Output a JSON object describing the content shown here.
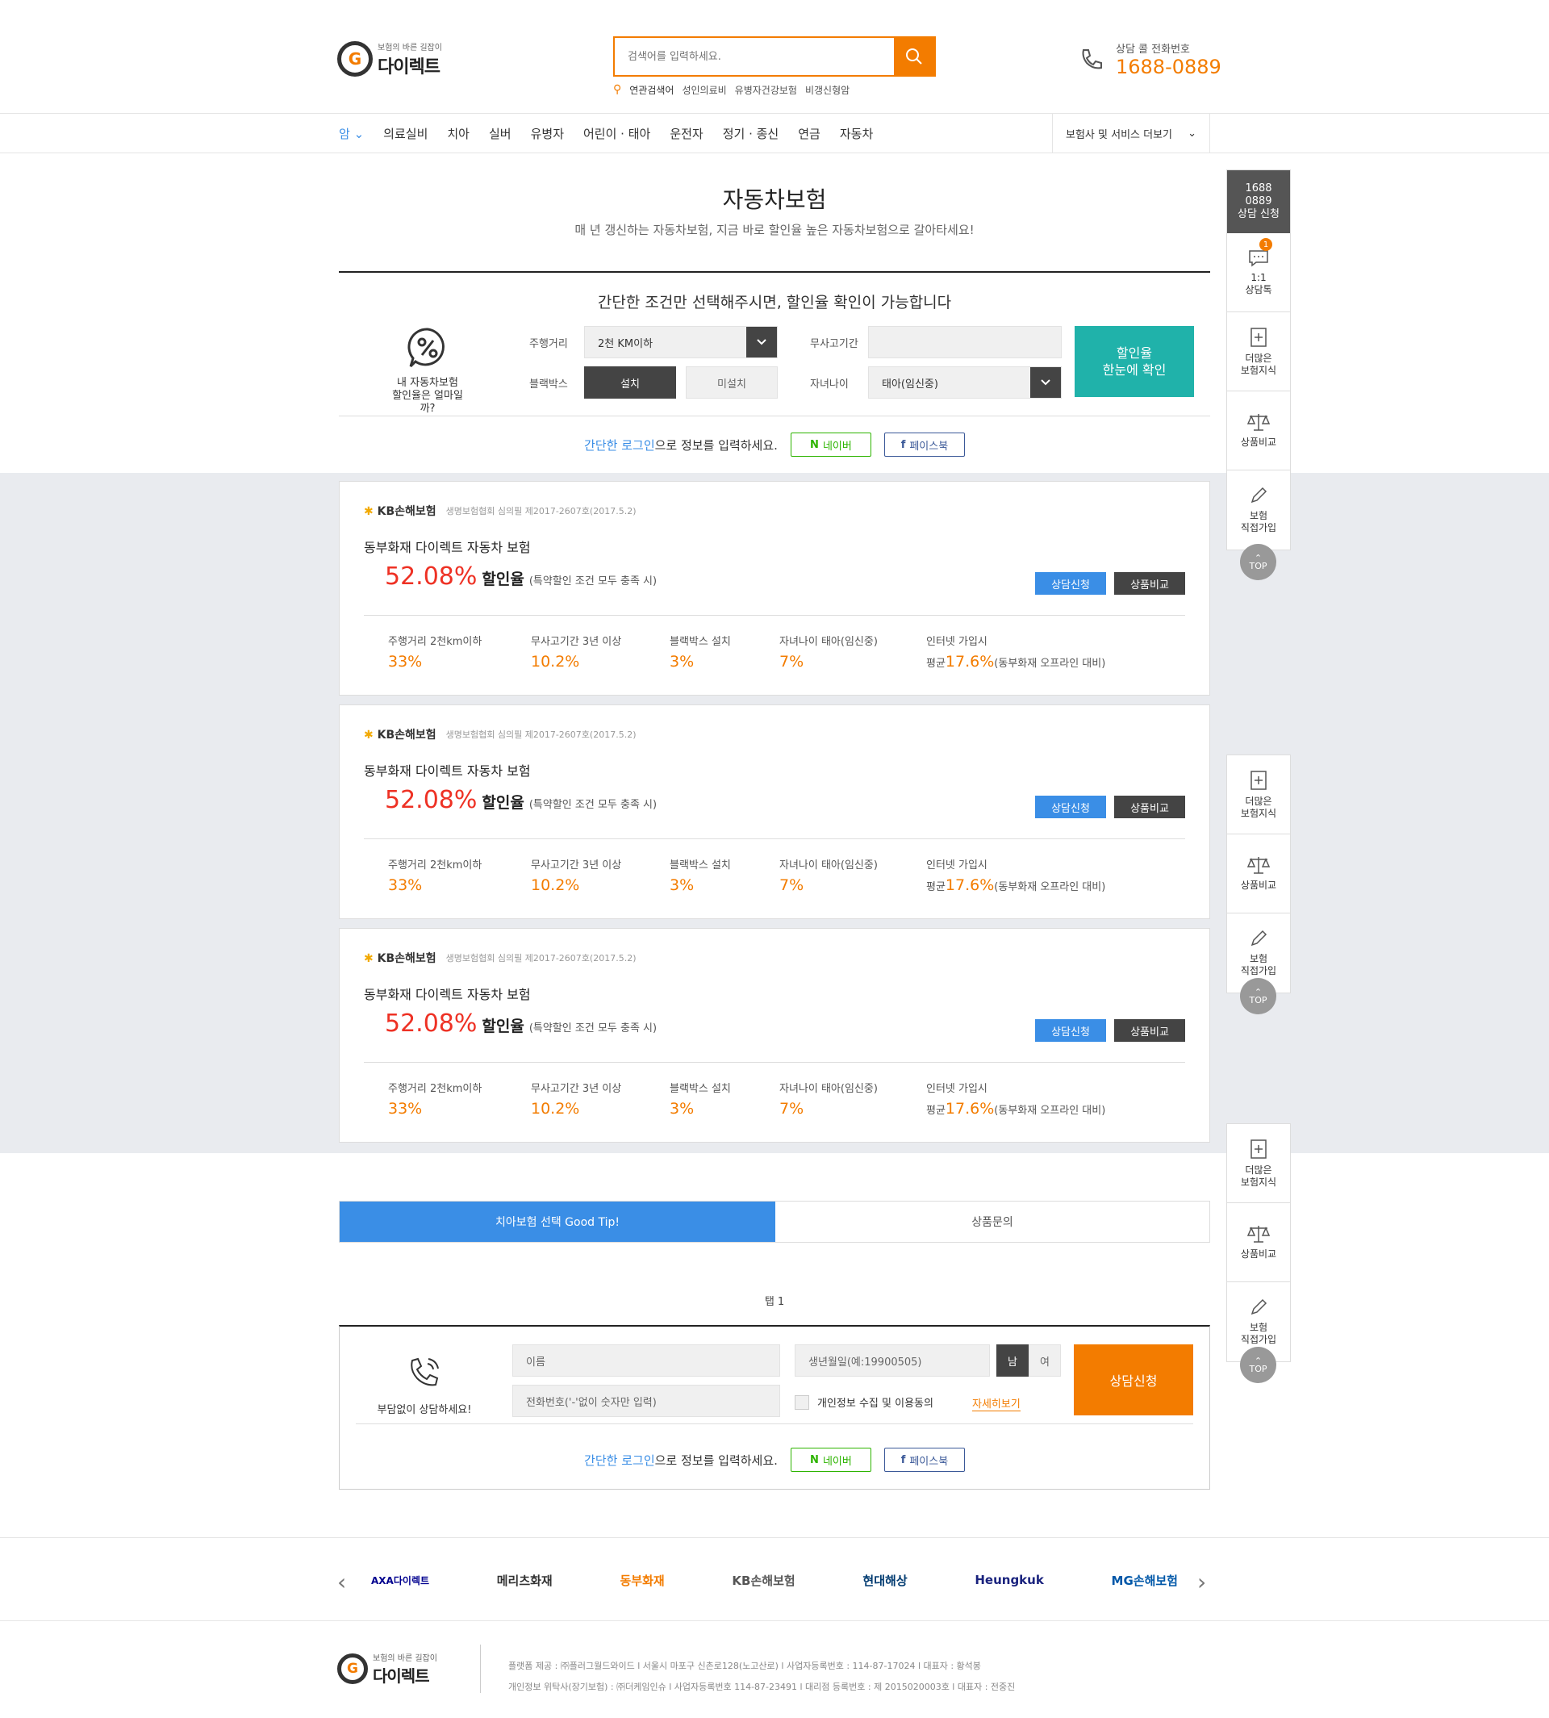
{
  "header": {
    "logo_sub": "보험의 바른 길잡이",
    "logo_main": "다이렉트",
    "search_placeholder": "검색어를 입력하세요.",
    "related_label": "연관검색어",
    "related_terms": [
      "성인의료비",
      "유병자건강보험",
      "비갱신형암"
    ],
    "phone_label": "상담 콜 전화번호",
    "phone_number": "1688-0889"
  },
  "nav": {
    "items": [
      "암",
      "의료실비",
      "치아",
      "실버",
      "유병자",
      "어린이 · 태아",
      "운전자",
      "정기 · 종신",
      "연금",
      "자동차"
    ],
    "more": "보험사 및 서비스 더보기"
  },
  "page": {
    "title": "자동차보험",
    "subtitle": "매 년 갱신하는 자동차보험, 지금 바로 할인율 높은 자동차보험으로 갈아타세요!"
  },
  "calc": {
    "headline": "간단한 조건만 선택해주시면, 할인율 확인이 가능합니다",
    "icon_caption_1": "내 자동차보험",
    "icon_caption_2": "할인율은 얼마일까?",
    "mileage_label": "주행거리",
    "mileage_value": "2천 KM이하",
    "blackbox_label": "블랙박스",
    "blackbox_yes": "설치",
    "blackbox_no": "미설치",
    "noaccident_label": "무사고기간",
    "noaccident_value": "",
    "child_label": "자녀나이",
    "child_value": "태아(임신중)",
    "submit_1": "할인율",
    "submit_2": "한눈에 확인"
  },
  "login": {
    "link": "간단한 로그인",
    "text": "으로 정보를 입력하세요.",
    "naver": "네이버",
    "facebook": "페이스북"
  },
  "cards": [
    {
      "insurer": "KB손해보험",
      "reg": "생명보험협회 심의필 제2017-2607호(2017.5.2)",
      "title": "동부화재 다이렉트 자동차 보험",
      "rate": "52.08%",
      "rate_label": "할인율",
      "note": "(특약할인 조건 모두 충족 시)",
      "btn_consult": "상담신청",
      "btn_compare": "상품비교",
      "stats": [
        {
          "label": "주행거리 2천km이하",
          "value": "33%"
        },
        {
          "label": "무사고기간 3년 이상",
          "value": "10.2%"
        },
        {
          "label": "블랙박스 설치",
          "value": "3%"
        },
        {
          "label": "자녀나이 태아(임신중)",
          "value": "7%"
        }
      ],
      "internet_label": "인터넷 가입시",
      "internet_prefix": "평균",
      "internet_value": "17.6%",
      "internet_note": "(동부화재 오프라인 대비)"
    },
    {
      "insurer": "KB손해보험",
      "reg": "생명보험협회 심의필 제2017-2607호(2017.5.2)",
      "title": "동부화재 다이렉트 자동차 보험",
      "rate": "52.08%",
      "rate_label": "할인율",
      "note": "(특약할인 조건 모두 충족 시)",
      "btn_consult": "상담신청",
      "btn_compare": "상품비교",
      "stats": [
        {
          "label": "주행거리 2천km이하",
          "value": "33%"
        },
        {
          "label": "무사고기간 3년 이상",
          "value": "10.2%"
        },
        {
          "label": "블랙박스 설치",
          "value": "3%"
        },
        {
          "label": "자녀나이 태아(임신중)",
          "value": "7%"
        }
      ],
      "internet_label": "인터넷 가입시",
      "internet_prefix": "평균",
      "internet_value": "17.6%",
      "internet_note": "(동부화재 오프라인 대비)"
    },
    {
      "insurer": "KB손해보험",
      "reg": "생명보험협회 심의필 제2017-2607호(2017.5.2)",
      "title": "동부화재 다이렉트 자동차 보험",
      "rate": "52.08%",
      "rate_label": "할인율",
      "note": "(특약할인 조건 모두 충족 시)",
      "btn_consult": "상담신청",
      "btn_compare": "상품비교",
      "stats": [
        {
          "label": "주행거리 2천km이하",
          "value": "33%"
        },
        {
          "label": "무사고기간 3년 이상",
          "value": "10.2%"
        },
        {
          "label": "블랙박스 설치",
          "value": "3%"
        },
        {
          "label": "자녀나이 태아(임신중)",
          "value": "7%"
        }
      ],
      "internet_label": "인터넷 가입시",
      "internet_prefix": "평균",
      "internet_value": "17.6%",
      "internet_note": "(동부화재 오프라인 대비)"
    }
  ],
  "tabs": {
    "tab1": "치아보험 선택 Good Tip!",
    "tab2": "상품문의",
    "panel": "탭 1"
  },
  "consult": {
    "caption": "부담없이 상담하세요!",
    "name_ph": "이름",
    "phone_ph": "전화번호('-'없이 숫자만 입력)",
    "birth_ph": "생년월일(예:19900505)",
    "male": "남",
    "female": "여",
    "agree": "개인정보 수집 및 이용동의",
    "detail": "자세히보기",
    "submit": "상담신청"
  },
  "partners": [
    "AXA다이렉트",
    "메리츠화재",
    "동부화재",
    "KB손해보험",
    "현대해상",
    "Heungkuk",
    "MG손해보험"
  ],
  "footer": {
    "line1": "플랫폼 제공 : ㈜플러그월드와이드 l 서울시 마포구 신촌로128(노고산로) l 사업자등록번호 : 114-87-17024 l 대표자 : 황석봉",
    "line2": "개인정보 위탁사(장기보험) : ㈜더케임인슈 l 사업자등록번호 114-87-23491 l 대리점 등록번호 : 제 2015020003호 l 대표자 : 전중진"
  },
  "quick": {
    "tel_1": "1688",
    "tel_2": "0889",
    "tel_3": "상담 신청",
    "chat_1": "1:1",
    "chat_2": "상담톡",
    "chat_badge": "1",
    "knowledge_1": "더많은",
    "knowledge_2": "보험지식",
    "compare": "상품비교",
    "join_1": "보험",
    "join_2": "직접가입",
    "top": "TOP"
  },
  "colors": {
    "accent": "#f37c00",
    "blue": "#3a8ee6",
    "teal": "#20b2aa",
    "red": "#ee3124"
  }
}
